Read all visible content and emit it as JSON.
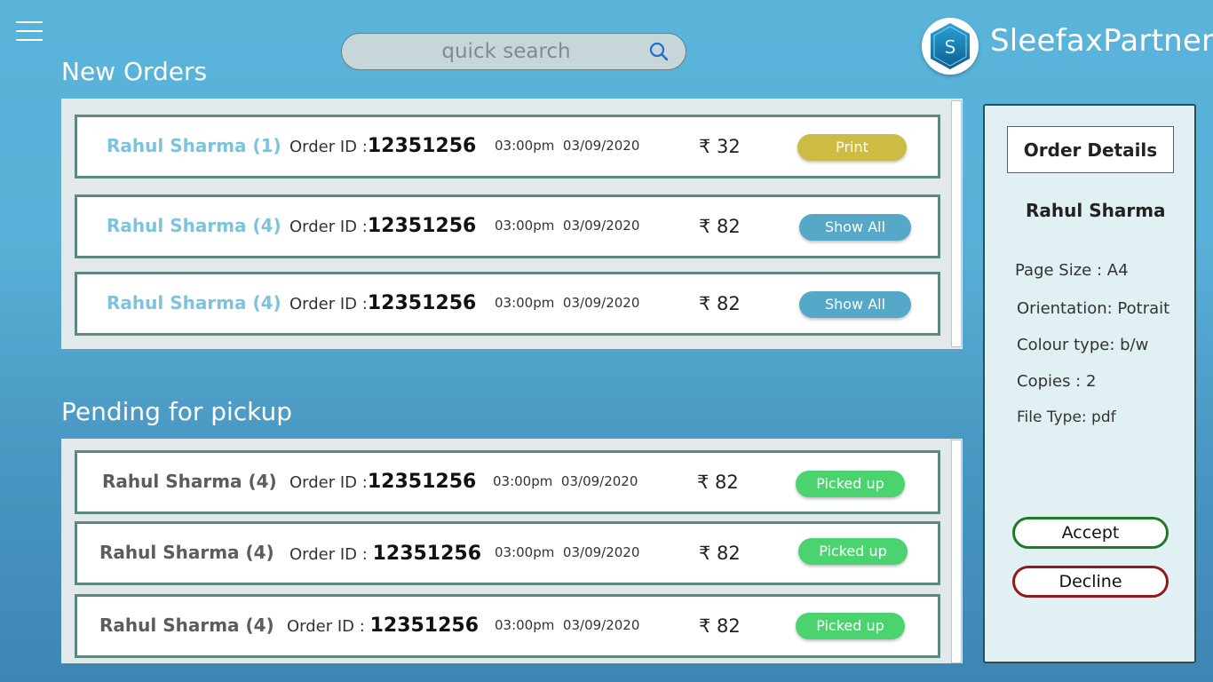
{
  "app": {
    "brand_name": "SleefaxPartner",
    "logo_letter": "S"
  },
  "search": {
    "placeholder": "quick search"
  },
  "new_orders": {
    "title": "New Orders",
    "items": [
      {
        "name": "Rahul Sharma (1)",
        "order_label": "Order ID :",
        "order_id": "12351256",
        "time": "03:00pm",
        "date": "03/09/2020",
        "price": "₹ 32",
        "action": "Print"
      },
      {
        "name": "Rahul Sharma (4)",
        "order_label": "Order ID :",
        "order_id": "12351256",
        "time": "03:00pm",
        "date": "03/09/2020",
        "price": "₹ 82",
        "action": "Show All"
      },
      {
        "name": "Rahul Sharma (4)",
        "order_label": "Order ID :",
        "order_id": "12351256",
        "time": "03:00pm",
        "date": "03/09/2020",
        "price": "₹ 82",
        "action": "Show All"
      }
    ]
  },
  "pending": {
    "title": "Pending for pickup",
    "items": [
      {
        "name": "Rahul Sharma (4)",
        "order_label": "Order ID :",
        "order_id": "12351256",
        "time": "03:00pm",
        "date": "03/09/2020",
        "price": "₹ 82",
        "action": "Picked up"
      },
      {
        "name": "Rahul Sharma (4)",
        "order_label": "Order ID :",
        "order_id": "12351256",
        "time": "03:00pm",
        "date": "03/09/2020",
        "price": "₹ 82",
        "action": "Picked up"
      },
      {
        "name": "Rahul Sharma (4)",
        "order_label": "Order ID :",
        "order_id": "12351256",
        "time": "03:00pm",
        "date": "03/09/2020",
        "price": "₹ 82",
        "action": "Picked up"
      }
    ]
  },
  "details": {
    "title": "Order Details",
    "customer": "Rahul Sharma",
    "page_size": "Page Size : A4",
    "orientation": "Orientation: Potrait",
    "colour_type": "Colour type: b/w",
    "copies": "Copies : 2",
    "file_type": "File Type: pdf",
    "accept_label": "Accept",
    "decline_label": "Decline"
  },
  "colors": {
    "background": "#58b1d8",
    "print_button": "#cebb43",
    "show_all_button": "#55a8c7",
    "picked_up_button": "#4ad36e",
    "accept_border": "#1e7a24",
    "decline_border": "#8d1b1b"
  },
  "icons": {
    "menu": "hamburger-menu-icon",
    "search": "search-icon",
    "logo": "hexagon-logo-icon"
  }
}
